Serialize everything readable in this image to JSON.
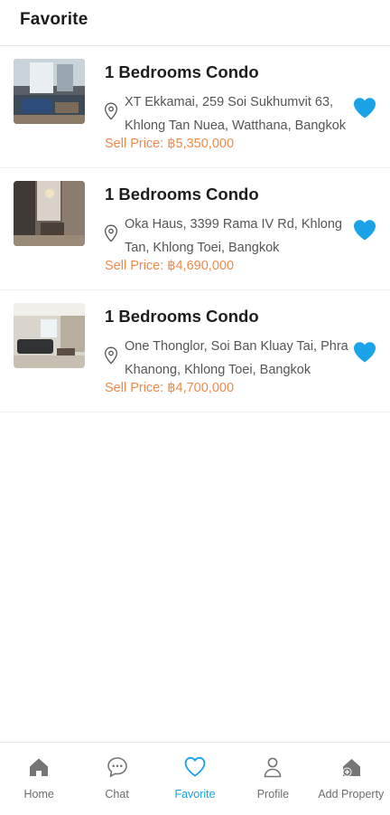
{
  "header": {
    "title": "Favorite"
  },
  "listings": [
    {
      "title": "1 Bedrooms Condo",
      "address": "XT Ekkamai, 259 Soi Sukhumvit 63, Khlong Tan Nuea, Watthana, Bangkok",
      "price": "Sell Price: ฿5,350,000",
      "photo_icon": "condo-photo"
    },
    {
      "title": "1 Bedrooms Condo",
      "address": "Oka Haus, 3399 Rama IV Rd, Khlong Tan, Khlong Toei, Bangkok",
      "price": "Sell Price: ฿4,690,000",
      "photo_icon": "condo-photo"
    },
    {
      "title": "1 Bedrooms Condo",
      "address": "One Thonglor, Soi Ban Kluay Tai, Phra Khanong, Khlong Toei, Bangkok",
      "price": "Sell Price: ฿4,700,000",
      "photo_icon": "condo-photo"
    }
  ],
  "tabbar": {
    "items": [
      {
        "label": "Home",
        "icon": "home-icon",
        "active": false
      },
      {
        "label": "Chat",
        "icon": "chat-icon",
        "active": false
      },
      {
        "label": "Favorite",
        "icon": "heart-icon",
        "active": true
      },
      {
        "label": "Profile",
        "icon": "profile-icon",
        "active": false
      },
      {
        "label": "Add Property",
        "icon": "add-property-icon",
        "active": false
      }
    ]
  },
  "colors": {
    "accent": "#1aa3e8",
    "price": "#f08a4b",
    "tab_inactive": "#6d6d6d",
    "text": "#1d1d1d"
  }
}
